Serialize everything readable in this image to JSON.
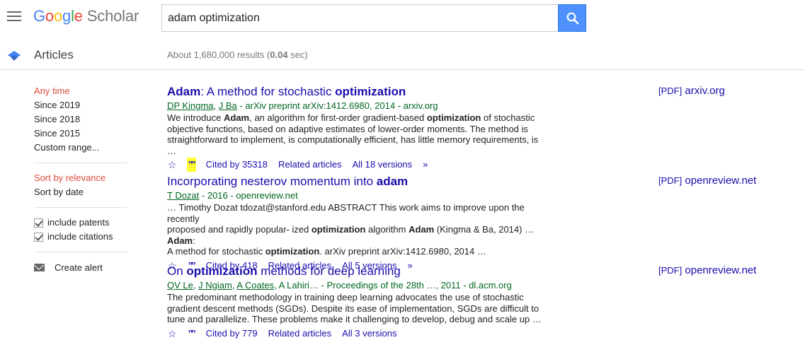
{
  "header": {
    "logo_google": [
      "G",
      "o",
      "o",
      "g",
      "l",
      "e"
    ],
    "logo_scholar": "Scholar",
    "search_value": "adam optimization"
  },
  "subheader": {
    "section": "Articles",
    "results_prefix": "About 1,680,000 results (",
    "results_time": "0.04",
    "results_suffix": " sec)"
  },
  "sidebar": {
    "time_filters": [
      "Any time",
      "Since 2019",
      "Since 2018",
      "Since 2015",
      "Custom range..."
    ],
    "sort_options": [
      "Sort by relevance",
      "Sort by date"
    ],
    "checks": [
      "include patents",
      "include citations"
    ],
    "create_alert": "Create alert"
  },
  "results": [
    {
      "title_parts": [
        {
          "t": "Adam",
          "b": true
        },
        {
          "t": ": A method for stochastic ",
          "b": false
        },
        {
          "t": "optimization",
          "b": true
        }
      ],
      "authors": [
        "DP Kingma",
        "J Ba"
      ],
      "source": " - arXiv preprint arXiv:1412.6980, 2014 - arxiv.org",
      "snippet_lines": [
        [
          {
            "t": "We introduce ",
            "b": false
          },
          {
            "t": "Adam",
            "b": true
          },
          {
            "t": ", an algorithm for first-order gradient-based ",
            "b": false
          },
          {
            "t": "optimization",
            "b": true
          },
          {
            "t": " of stochastic",
            "b": false
          }
        ],
        [
          {
            "t": "objective functions, based on adaptive estimates of lower-order moments. The method is",
            "b": false
          }
        ],
        [
          {
            "t": "straightforward to implement, is computationally efficient, has little memory requirements, is …",
            "b": false
          }
        ]
      ],
      "cited": "Cited by 35318",
      "related": "Related articles",
      "versions": "All 18 versions",
      "pdf_tag": "[PDF]",
      "pdf_host": "arxiv.org",
      "quote_highlight": true
    },
    {
      "title_parts": [
        {
          "t": "Incorporating nesterov momentum into ",
          "b": false
        },
        {
          "t": "adam",
          "b": true
        }
      ],
      "authors": [
        "T Dozat"
      ],
      "source": " - 2016 - openreview.net",
      "snippet_lines": [
        [
          {
            "t": "… Timothy Dozat tdozat@stanford.edu ABSTRACT This work aims to improve upon the recently",
            "b": false
          }
        ],
        [
          {
            "t": "proposed and rapidly popular- ized ",
            "b": false
          },
          {
            "t": "optimization",
            "b": true
          },
          {
            "t": " algorithm ",
            "b": false
          },
          {
            "t": "Adam",
            "b": true
          },
          {
            "t": " (Kingma & Ba, 2014) … ",
            "b": false
          },
          {
            "t": "Adam",
            "b": true
          },
          {
            "t": ":",
            "b": false
          }
        ],
        [
          {
            "t": "A method for stochastic ",
            "b": false
          },
          {
            "t": "optimization",
            "b": true
          },
          {
            "t": ". arXiv preprint arXiv:1412.6980, 2014 …",
            "b": false
          }
        ]
      ],
      "cited": "Cited by 418",
      "related": "Related articles",
      "versions": "All 5 versions",
      "pdf_tag": "[PDF]",
      "pdf_host": "openreview.net",
      "quote_highlight": false
    },
    {
      "title_parts": [
        {
          "t": "On ",
          "b": false
        },
        {
          "t": "optimization",
          "b": true
        },
        {
          "t": " methods for deep learning",
          "b": false
        }
      ],
      "authors": [
        "QV Le",
        "J Ngiam",
        "A Coates"
      ],
      "source": ", A Lahiri… - Proceedings of the 28th …, 2011 - dl.acm.org",
      "snippet_lines": [
        [
          {
            "t": "The predominant methodology in training deep learning advocates the use of stochastic",
            "b": false
          }
        ],
        [
          {
            "t": "gradient descent methods (SGDs). Despite its ease of implementation, SGDs are difficult to",
            "b": false
          }
        ],
        [
          {
            "t": "tune and parallelize. These problems make it challenging to develop, debug and scale up …",
            "b": false
          }
        ]
      ],
      "cited": "Cited by 779",
      "related": "Related articles",
      "versions": "All 3 versions",
      "pdf_tag": "[PDF]",
      "pdf_host": "openreview.net",
      "quote_highlight": false
    }
  ],
  "icons": {
    "menu": "hamburger-menu-icon",
    "search": "search-icon",
    "cap": "scholar-cap-icon",
    "star": "star-icon",
    "quote": "quote-icon",
    "more": "double-chevron-icon",
    "mail": "mail-icon"
  },
  "colors": {
    "link": "#1a0dab",
    "green": "#006621",
    "active": "#dd4b39",
    "search_btn": "#4d90fe",
    "highlight": "#ffff33"
  }
}
